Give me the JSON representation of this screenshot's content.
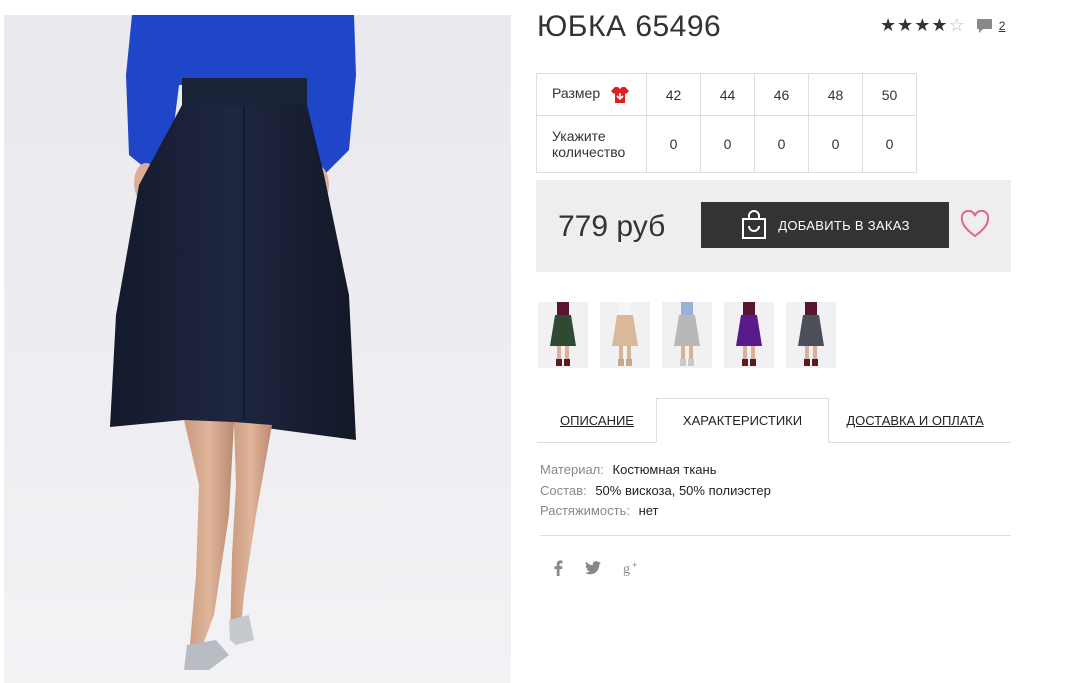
{
  "product": {
    "title": "ЮБКА 65496"
  },
  "rating": {
    "stars_filled": 4,
    "stars_total": 5,
    "comments_count": "2"
  },
  "size_table": {
    "size_label": "Размер",
    "quantity_label_line1": "Укажите",
    "quantity_label_line2": "количество",
    "sizes": [
      "42",
      "44",
      "46",
      "48",
      "50"
    ],
    "quantities": [
      "0",
      "0",
      "0",
      "0",
      "0"
    ]
  },
  "buy": {
    "price": "779 руб",
    "add_button_label": "ДОБАВИТЬ В ЗАКАЗ"
  },
  "tabs": {
    "description": "ОПИСАНИЕ",
    "characteristics": "ХАРАКТЕРИСТИКИ",
    "delivery": "ДОСТАВКА И ОПЛАТА"
  },
  "specs": [
    {
      "key": "Материал:",
      "value": "Костюмная ткань"
    },
    {
      "key": "Состав:",
      "value": "50% вискоза, 50% полиэстер"
    },
    {
      "key": "Растяжимость:",
      "value": "нет"
    }
  ],
  "thumbnail_colors": [
    "#2f4a33",
    "#d9b99a",
    "#b8b8b8",
    "#5a1b8a",
    "#4a4f5a"
  ],
  "colors": {
    "skirt": "#1a2238",
    "top": "#1f45c8",
    "button_bg": "#333333",
    "heart": "#e0678a",
    "size_icon": "#e02020"
  }
}
